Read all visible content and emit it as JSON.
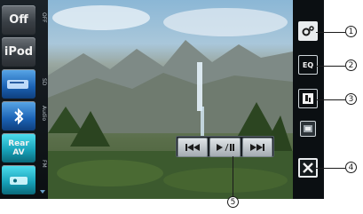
{
  "sidebar": {
    "sources": [
      "Off",
      "iPod",
      "",
      "",
      "Rear AV",
      ""
    ],
    "tabs": [
      "OFF",
      "SD",
      "Audio",
      "FM"
    ]
  },
  "right_icons": {
    "settings": "settings-icon",
    "eq": "EQ",
    "media": "media-icon",
    "photo": "photo-icon",
    "close": "close-icon"
  },
  "transport": {
    "prev": "previous-track-icon",
    "play_pause": "play-pause-icon",
    "next": "next-track-icon"
  },
  "callouts": [
    "1",
    "2",
    "3",
    "4",
    "5"
  ],
  "colors": {
    "accent_blue": "#1b62b4",
    "accent_teal": "#169fb6",
    "dark_bg": "#0e1416"
  }
}
